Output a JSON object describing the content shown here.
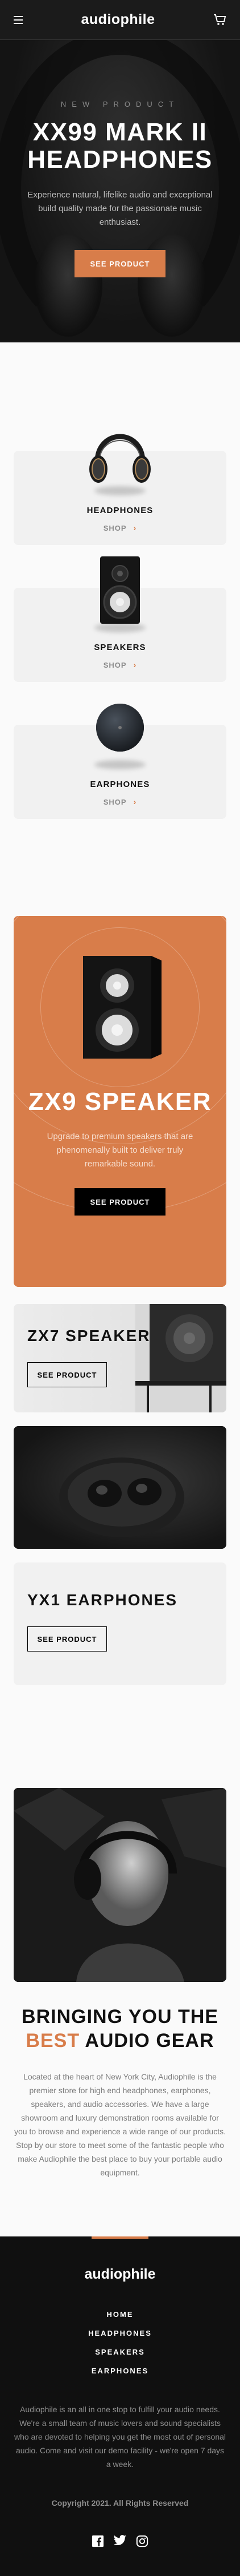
{
  "header": {
    "menu_icon": "hamburger-icon",
    "logo": "audiophile",
    "cart_icon": "cart-icon"
  },
  "hero": {
    "overline": "NEW PRODUCT",
    "title": "XX99 MARK II HEADPHONES",
    "description": "Experience natural, lifelike audio and exceptional build quality made for the passionate music enthusiast.",
    "cta": "SEE PRODUCT"
  },
  "categories": [
    {
      "name": "HEADPHONES",
      "shop": "SHOP",
      "icon": "headphones-icon"
    },
    {
      "name": "SPEAKERS",
      "shop": "SHOP",
      "icon": "speaker-icon"
    },
    {
      "name": "EARPHONES",
      "shop": "SHOP",
      "icon": "earphones-icon"
    }
  ],
  "zx9": {
    "title": "ZX9 SPEAKER",
    "description": "Upgrade to premium speakers that are phenomenally built to deliver truly remarkable sound.",
    "cta": "SEE PRODUCT"
  },
  "zx7": {
    "title": "ZX7 SPEAKER",
    "cta": "SEE PRODUCT"
  },
  "yx1": {
    "title": "YX1 EARPHONES",
    "cta": "SEE PRODUCT"
  },
  "about": {
    "title_pre": "BRINGING YOU THE",
    "title_accent": "BEST",
    "title_post": "AUDIO GEAR",
    "description": "Located at the heart of New York City, Audiophile is the premier store for high end headphones, earphones, speakers, and audio accessories. We have a large showroom and luxury demonstration rooms available for you to browse and experience a wide range of our products. Stop by our store to meet some of the fantastic people who make Audiophile the best place to buy your portable audio equipment."
  },
  "footer": {
    "logo": "audiophile",
    "nav": [
      "HOME",
      "HEADPHONES",
      "SPEAKERS",
      "EARPHONES"
    ],
    "description": "Audiophile is an all in one stop to fulfill your audio needs. We're a small team of music lovers and sound specialists who are devoted to helping you get the most out of personal audio. Come and visit our demo facility - we're open 7 days a week.",
    "copyright": "Copyright 2021. All Rights Reserved",
    "socials": [
      "facebook-icon",
      "twitter-icon",
      "instagram-icon"
    ]
  },
  "colors": {
    "accent": "#d87d4a",
    "dark": "#101010",
    "light": "#f1f1f1"
  }
}
